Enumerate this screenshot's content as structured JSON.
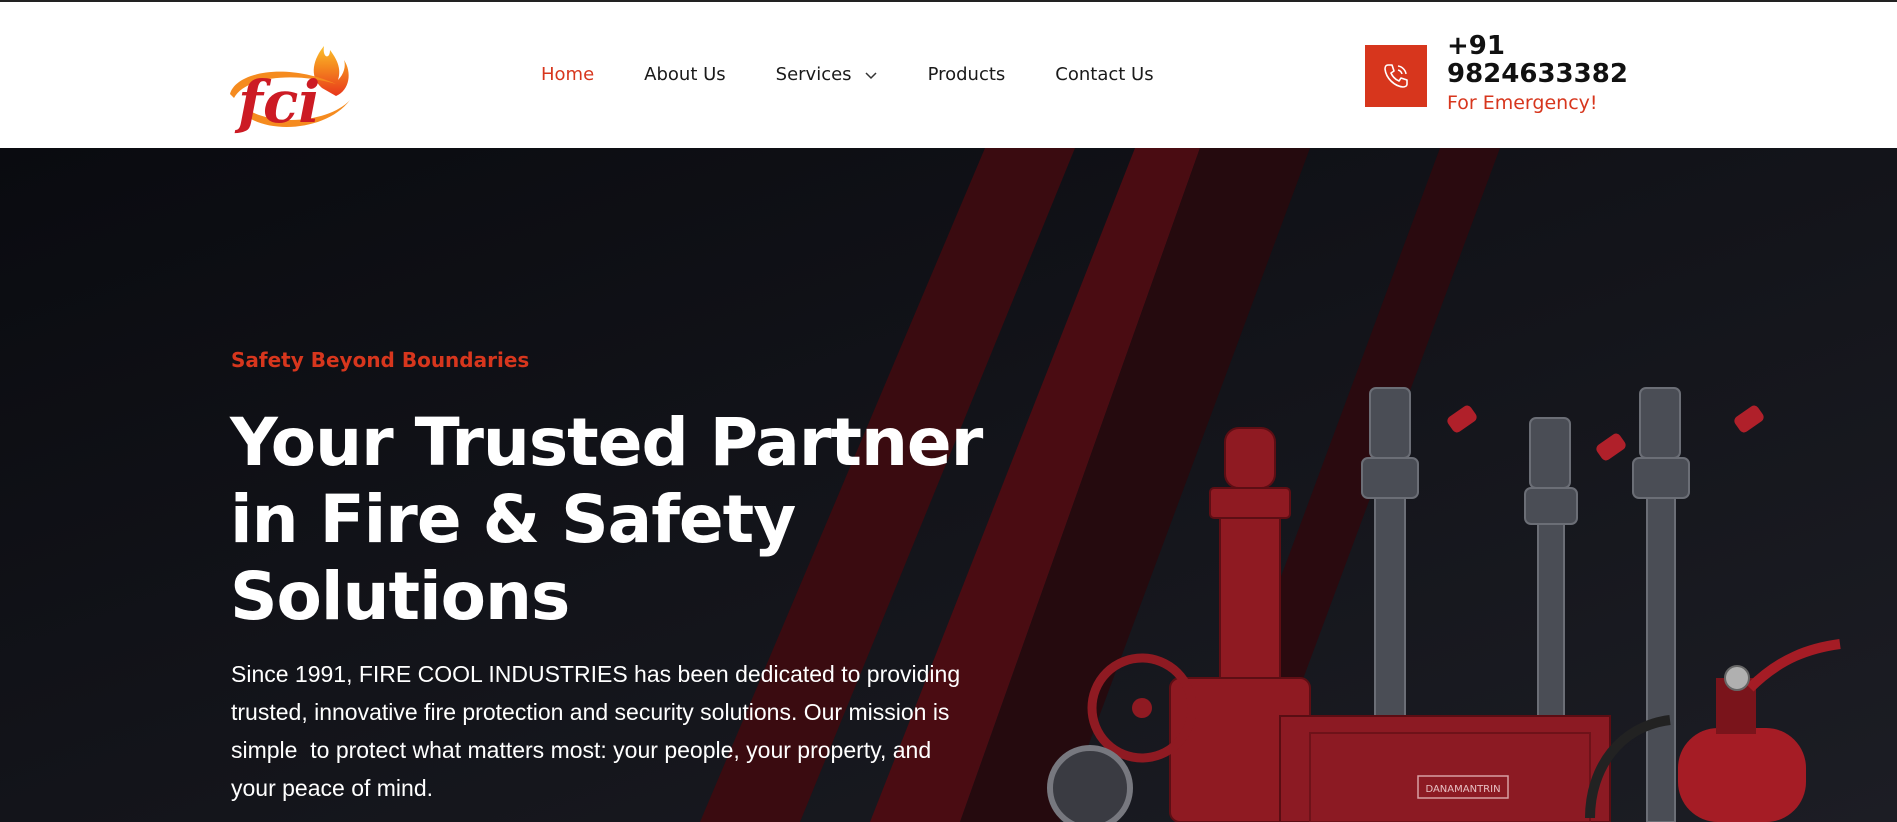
{
  "brand": {
    "logo_text": "fci",
    "logo_name": "FIRE COOL INDUSTRIES"
  },
  "nav": {
    "items": [
      {
        "label": "Home",
        "active": true
      },
      {
        "label": "About Us",
        "active": false
      },
      {
        "label": "Services",
        "active": false,
        "dropdown": true
      },
      {
        "label": "Products",
        "active": false
      },
      {
        "label": "Contact Us",
        "active": false
      }
    ]
  },
  "contact": {
    "phone": "+91 9824633382",
    "caption": "For Emergency!",
    "icon": "phone-icon"
  },
  "hero": {
    "tagline": "Safety Beyond Boundaries",
    "headline": "Your Trusted Partner in Fire & Safety Solutions",
    "description": "Since 1991, FIRE COOL INDUSTRIES has been dedicated to providing trusted, innovative fire protection and security solutions. Our mission is simple  to protect what matters most: your people, your property, and your peace of mind.",
    "cabinet_label": "DANAMANTRIN"
  },
  "colors": {
    "accent": "#d7361d",
    "hero_bg": "#0a0b10",
    "text_dark": "#1a1a1a"
  }
}
